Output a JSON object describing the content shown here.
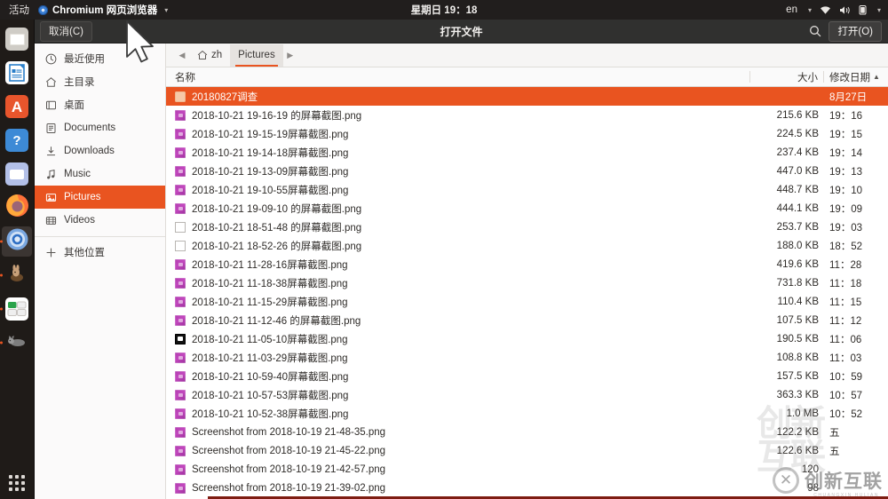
{
  "topbar": {
    "activities": "活动",
    "app_name": "Chromium 网页浏览器",
    "app_icon": "chromium-icon",
    "caret": "▾",
    "clock_day": "星期日",
    "clock_time": "19：18",
    "language": "en",
    "lang_caret": "▾",
    "wifi_icon": "wifi-icon",
    "volume_icon": "volume-icon",
    "battery_icon": "battery-icon",
    "menu_caret": "▾"
  },
  "dock": {
    "items": [
      {
        "name": "files-app",
        "icon": "file-manager-icon",
        "running": false,
        "active": false
      },
      {
        "name": "libreoffice-writer",
        "icon": "document-icon",
        "running": false,
        "active": false
      },
      {
        "name": "libreoffice-app",
        "icon": "letter-a-icon",
        "running": false,
        "active": false
      },
      {
        "name": "help-app",
        "icon": "question-mark-icon",
        "running": false,
        "active": false
      },
      {
        "name": "thunderbird-mail",
        "icon": "envelope-icon",
        "running": false,
        "active": false
      },
      {
        "name": "firefox",
        "icon": "firefox-icon",
        "running": false,
        "active": false
      },
      {
        "name": "chromium",
        "icon": "chromium-icon",
        "running": true,
        "active": true
      },
      {
        "name": "unknown-app-rabbit",
        "icon": "rabbit-icon",
        "running": true,
        "active": false
      },
      {
        "name": "ubuntu-software",
        "icon": "software-center-icon",
        "running": true,
        "active": false
      },
      {
        "name": "unknown-app-cat",
        "icon": "cat-icon",
        "running": true,
        "active": false
      }
    ],
    "app_grid_icon": "app-grid-icon"
  },
  "dialog": {
    "title": "打开文件",
    "cancel_label": "取消(C)",
    "open_label": "打开(O)",
    "search_icon": "search-icon"
  },
  "sidebar": {
    "items": [
      {
        "label": "最近使用",
        "icon": "clock-icon",
        "selected": false
      },
      {
        "label": "主目录",
        "icon": "home-icon",
        "selected": false
      },
      {
        "label": "桌面",
        "icon": "desktop-icon",
        "selected": false
      },
      {
        "label": "Documents",
        "icon": "documents-icon",
        "selected": false
      },
      {
        "label": "Downloads",
        "icon": "downloads-icon",
        "selected": false
      },
      {
        "label": "Music",
        "icon": "music-note-icon",
        "selected": false
      },
      {
        "label": "Pictures",
        "icon": "pictures-icon",
        "selected": true
      },
      {
        "label": "Videos",
        "icon": "video-icon",
        "selected": false
      }
    ],
    "other_locations": {
      "label": "其他位置",
      "icon": "plus-icon"
    }
  },
  "pathbar": {
    "back_icon": "chevron-left-icon",
    "forward_icon": "chevron-right-icon",
    "crumbs": [
      {
        "label": "zh",
        "icon": "home-icon",
        "active": false
      },
      {
        "label": "Pictures",
        "icon": "",
        "active": true
      }
    ]
  },
  "filelist": {
    "columns": {
      "name": "名称",
      "size": "大小",
      "date": "修改日期",
      "sort_indicator": "▲"
    },
    "rows": [
      {
        "name": "20180827调查",
        "size": "",
        "date": "8月27日",
        "icon": "folder-icon",
        "selected": true
      },
      {
        "name": "2018-10-21 19-16-19 的屏幕截图.png",
        "size": "215.6 KB",
        "date": "19：16",
        "icon": "image-thumbnail",
        "selected": false
      },
      {
        "name": "2018-10-21 19-15-19屏幕截图.png",
        "size": "224.5 KB",
        "date": "19：15",
        "icon": "image-thumbnail",
        "selected": false
      },
      {
        "name": "2018-10-21 19-14-18屏幕截图.png",
        "size": "237.4 KB",
        "date": "19：14",
        "icon": "image-thumbnail",
        "selected": false
      },
      {
        "name": "2018-10-21 19-13-09屏幕截图.png",
        "size": "447.0 KB",
        "date": "19：13",
        "icon": "image-thumbnail",
        "selected": false
      },
      {
        "name": "2018-10-21 19-10-55屏幕截图.png",
        "size": "448.7 KB",
        "date": "19：10",
        "icon": "image-thumbnail",
        "selected": false
      },
      {
        "name": "2018-10-21 19-09-10 的屏幕截图.png",
        "size": "444.1 KB",
        "date": "19：09",
        "icon": "image-thumbnail",
        "selected": false
      },
      {
        "name": "2018-10-21 18-51-48 的屏幕截图.png",
        "size": "253.7 KB",
        "date": "19：03",
        "icon": "image-blank",
        "selected": false
      },
      {
        "name": "2018-10-21 18-52-26 的屏幕截图.png",
        "size": "188.0 KB",
        "date": "18：52",
        "icon": "image-blank",
        "selected": false
      },
      {
        "name": "2018-10-21 11-28-16屏幕截图.png",
        "size": "419.6 KB",
        "date": "11：28",
        "icon": "image-thumbnail",
        "selected": false
      },
      {
        "name": "2018-10-21 11-18-38屏幕截图.png",
        "size": "731.8 KB",
        "date": "11：18",
        "icon": "image-thumbnail",
        "selected": false
      },
      {
        "name": "2018-10-21 11-15-29屏幕截图.png",
        "size": "110.4 KB",
        "date": "11：15",
        "icon": "image-thumbnail",
        "selected": false
      },
      {
        "name": "2018-10-21 11-12-46 的屏幕截图.png",
        "size": "107.5 KB",
        "date": "11：12",
        "icon": "image-thumbnail",
        "selected": false
      },
      {
        "name": "2018-10-21 11-05-10屏幕截图.png",
        "size": "190.5 KB",
        "date": "11：06",
        "icon": "image-dark-thumbnail",
        "selected": false
      },
      {
        "name": "2018-10-21 11-03-29屏幕截图.png",
        "size": "108.8 KB",
        "date": "11：03",
        "icon": "image-thumbnail",
        "selected": false
      },
      {
        "name": "2018-10-21 10-59-40屏幕截图.png",
        "size": "157.5 KB",
        "date": "10：59",
        "icon": "image-thumbnail",
        "selected": false
      },
      {
        "name": "2018-10-21 10-57-53屏幕截图.png",
        "size": "363.3 KB",
        "date": "10：57",
        "icon": "image-thumbnail",
        "selected": false
      },
      {
        "name": "2018-10-21 10-52-38屏幕截图.png",
        "size": "1.0 MB",
        "date": "10：52",
        "icon": "image-thumbnail",
        "selected": false
      },
      {
        "name": "Screenshot from 2018-10-19 21-48-35.png",
        "size": "122.2 KB",
        "date": "五",
        "icon": "image-thumbnail",
        "selected": false
      },
      {
        "name": "Screenshot from 2018-10-19 21-45-22.png",
        "size": "122.6 KB",
        "date": "五",
        "icon": "image-thumbnail",
        "selected": false
      },
      {
        "name": "Screenshot from 2018-10-19 21-42-57.png",
        "size": "120",
        "date": "",
        "icon": "image-thumbnail",
        "selected": false
      },
      {
        "name": "Screenshot from 2018-10-19 21-39-02.png",
        "size": "98",
        "date": "",
        "icon": "image-thumbnail",
        "selected": false
      }
    ]
  },
  "watermark": {
    "big_line1": "创新",
    "big_line2": "互联",
    "logo_glyph": "✕",
    "logo_text": "创新互联",
    "logo_sub": "CHUANGXIN HULIAN"
  },
  "colors": {
    "accent": "#e95420",
    "topbar_bg": "#211e1d",
    "headerbar_bg": "#30302f",
    "sidebar_bg": "#fbfafa",
    "list_bg": "#ffffff"
  }
}
